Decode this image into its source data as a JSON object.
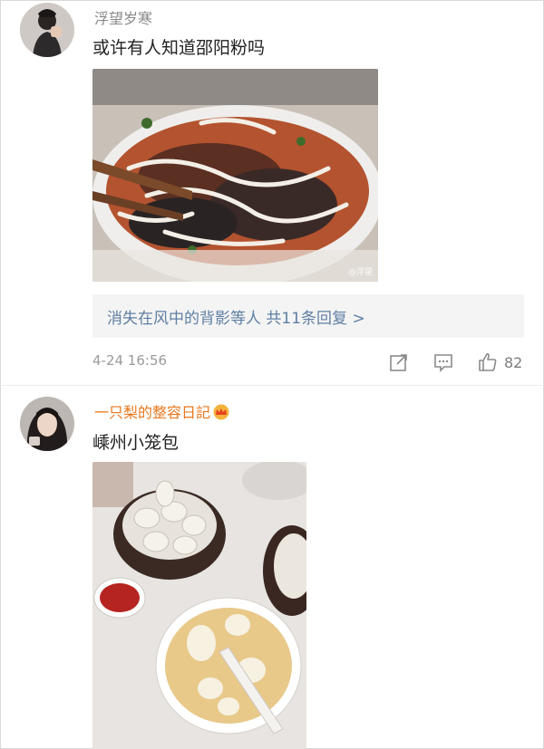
{
  "comments": [
    {
      "username": "浮望岁寒",
      "text": "或许有人知道邵阳粉吗",
      "image_watermark": "@浮望",
      "replies_summary": "消失在风中的背影等人  共11条回复 >",
      "timestamp": "4-24 16:56",
      "likes": "82",
      "username_color": "#888888"
    },
    {
      "username": "一只梨的整容日記",
      "text": "嵊州小笼包",
      "username_color": "#e8771e",
      "badge_icon": "crown-icon"
    }
  ],
  "icons": [
    "share-icon",
    "comment-icon",
    "like-icon"
  ]
}
